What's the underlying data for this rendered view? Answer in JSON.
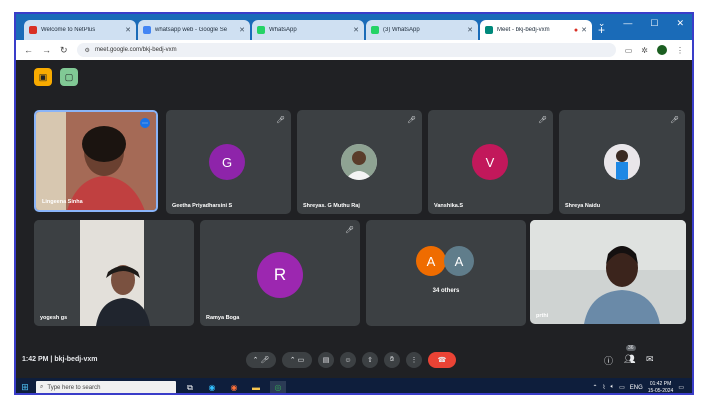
{
  "browser": {
    "tabs": [
      {
        "label": "Welcome to NetPlus",
        "favicon_color": "#d93025",
        "active": false
      },
      {
        "label": "whatsapp web - Google Se",
        "favicon_color": "#4285f4",
        "active": false
      },
      {
        "label": "WhatsApp",
        "favicon_color": "#25d366",
        "active": false
      },
      {
        "label": "(3) WhatsApp",
        "favicon_color": "#25d366",
        "active": false
      },
      {
        "label": "Meet - bkj-bedj-vxm",
        "favicon_color": "#00897b",
        "active": true
      }
    ],
    "url": "meet.google.com/bkj-bedj-vxm"
  },
  "meet": {
    "participants": [
      {
        "name": "Lingeena Sinha",
        "type": "video",
        "highlight": true
      },
      {
        "name": "Geetha Priyadharsini S",
        "type": "avatar",
        "initial": "G",
        "color": "#8e24aa"
      },
      {
        "name": "Shreyas. G Muthu Raj",
        "type": "photo"
      },
      {
        "name": "Vanshika.S",
        "type": "avatar",
        "initial": "V",
        "color": "#c2185b"
      },
      {
        "name": "Shreya Naidu",
        "type": "photo"
      },
      {
        "name": "yogesh gs",
        "type": "video"
      },
      {
        "name": "Ramya Boga",
        "type": "avatar",
        "initial": "R",
        "color": "#9c27b0"
      },
      {
        "name": "34 others",
        "type": "group",
        "initials": [
          "A",
          "A"
        ],
        "colors": [
          "#ef6c00",
          "#607d8b"
        ]
      },
      {
        "name": "prthi",
        "type": "video"
      }
    ],
    "meeting_info": {
      "time": "1:42 PM",
      "code": "bkj-bedj-vxm"
    },
    "participant_count": "36"
  },
  "taskbar": {
    "search_placeholder": "Type here to search",
    "clock_time": "01:42 PM",
    "clock_date": "15-05-2024",
    "lang": "ENG"
  }
}
